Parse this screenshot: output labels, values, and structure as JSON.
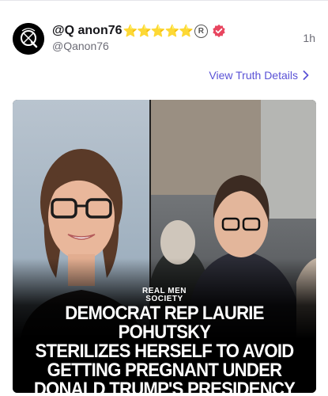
{
  "post": {
    "display_name": "@Q anon76",
    "stars": "⭐⭐⭐⭐⭐",
    "registered_mark": "R",
    "handle": "@Qanon76",
    "time": "1h",
    "details_link": "View Truth Details"
  },
  "media": {
    "brand_line1": "REAL MEN",
    "brand_line2": "SOCIETY",
    "headline": "DEMOCRAT REP LAURIE POHUTSKY\nSTERILIZES HERSELF TO AVOID\nGETTING PREGNANT UNDER\nDONALD TRUMP'S PRESIDENCY"
  },
  "colors": {
    "link": "#5a52d6",
    "verified_badge": "#e8455f",
    "star": "#f5c518",
    "text_primary": "#16161a",
    "text_secondary": "#6b6b75"
  },
  "icons": {
    "avatar": "q-emblem-avatar",
    "verified": "verified-badge-icon",
    "chevron": "chevron-right-icon"
  }
}
